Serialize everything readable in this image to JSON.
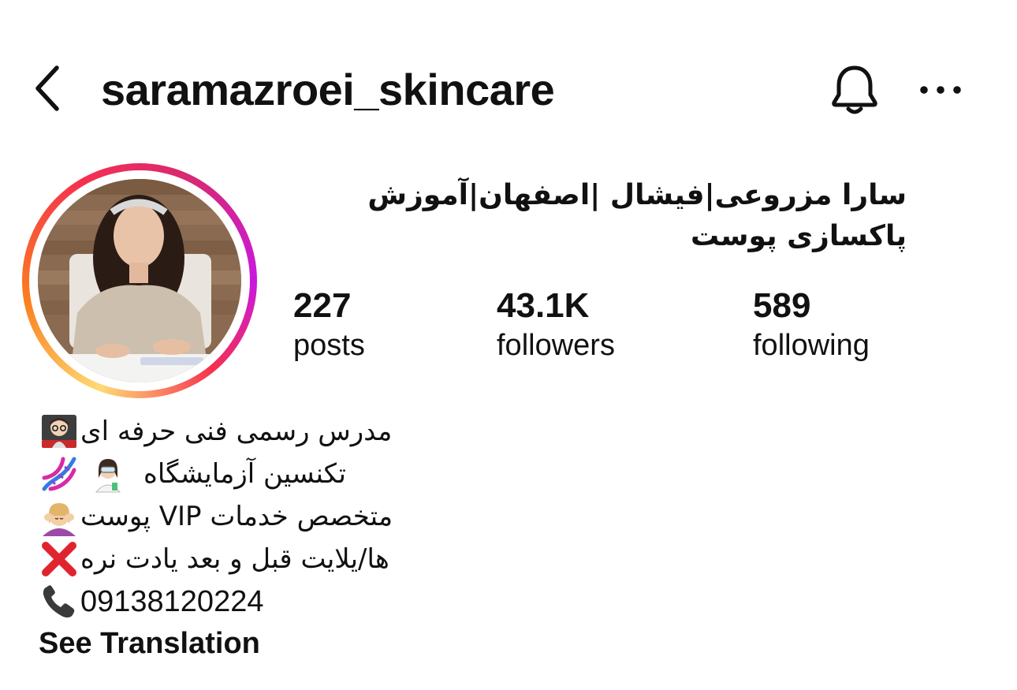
{
  "header": {
    "username": "saramazroei_skincare",
    "back_icon": "chevron-left-icon",
    "bell_icon": "bell-icon",
    "more_icon": "more-horizontal-icon"
  },
  "profile": {
    "display_name": "سارا مزروعی|فیشال |اصفهان|آموزش پاکسازی پوست",
    "avatar_ring_colors": [
      "#feda75",
      "#fa7e1e",
      "#d62976",
      "#c918e0"
    ]
  },
  "stats": {
    "posts": {
      "value": "227",
      "label": "posts"
    },
    "followers": {
      "value": "43.1K",
      "label": "followers"
    },
    "following": {
      "value": "589",
      "label": "following"
    }
  },
  "bio": {
    "lines": [
      {
        "text": "مدرس رسمی فنی حرفه ای",
        "emoji": "teacher-emoji"
      },
      {
        "text": "تکنسین آزمایشگاه",
        "emoji": "dna-emoji",
        "emoji2": "scientist-emoji"
      },
      {
        "text": "متخصص خدمات VIP پوست",
        "emoji": "face-massage-emoji"
      },
      {
        "text": "ها/یلایت قبل و بعد یادت نره",
        "emoji": "cross-mark-emoji"
      },
      {
        "text": "09138120224",
        "emoji": "telephone-emoji"
      }
    ],
    "see_translation": "See Translation"
  }
}
